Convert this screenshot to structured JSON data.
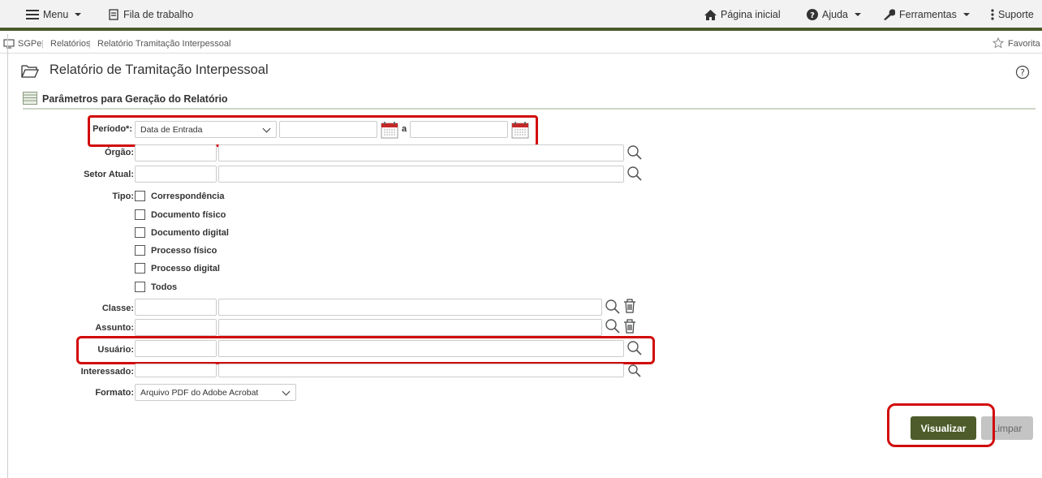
{
  "topbar": {
    "menu_label": "Menu",
    "worklist_label": "Fila de trabalho",
    "home_label": "Página inicial",
    "help_label": "Ajuda",
    "tools_label": "Ferramentas",
    "support_label": "Suporte"
  },
  "breadcrumb": {
    "items": [
      "SGPe",
      "Relatórios",
      "Relatório Tramitação Interpessoal"
    ],
    "favorites_label": "Favorita"
  },
  "page": {
    "title": "Relatório de Tramitação Interpessoal",
    "help_glyph": "?"
  },
  "section": {
    "title": "Parâmetros para Geração do Relatório"
  },
  "form": {
    "periodo_label": "Período*:",
    "periodo_type": "Data de Entrada",
    "periodo_sep": "a",
    "orgao_label": "Órgão:",
    "setor_label": "Setor Atual:",
    "tipo_label": "Tipo:",
    "tipo_options": [
      "Correspondência",
      "Documento físico",
      "Documento digital",
      "Processo físico",
      "Processo digital",
      "Todos"
    ],
    "classe_label": "Classe:",
    "assunto_label": "Assunto:",
    "usuario_label": "Usuário:",
    "interessado_label": "Interessado:",
    "formato_label": "Formato:",
    "formato_value": "Arquivo PDF do Adobe Acrobat"
  },
  "actions": {
    "view_label": "Visualizar",
    "clear_label": "Limpar"
  },
  "colors": {
    "brand_green": "#4a5a2a",
    "highlight_red": "#d10a0a",
    "button_green": "#4d5c2a",
    "button_gray": "#c4c4c4"
  }
}
